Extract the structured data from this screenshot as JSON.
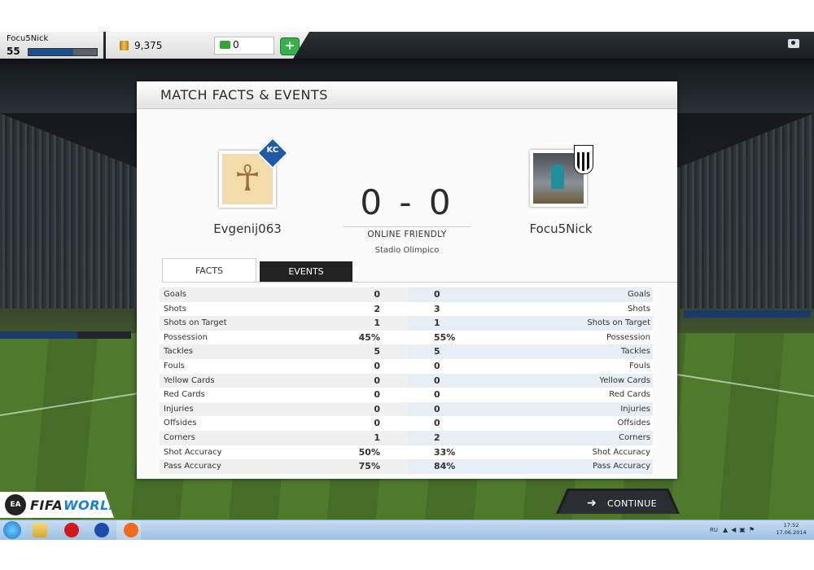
{
  "topbar": {
    "username": "Focu5Nick",
    "level": "55",
    "xp_progress": 0.65,
    "coins": "9,375",
    "points": "0",
    "add_label": "+"
  },
  "dialog": {
    "title": "MATCH FACTS & EVENTS",
    "score": "0 - 0",
    "match_type": "ONLINE FRIENDLY",
    "stadium": "Stadio Olimpico",
    "home_team": "Evgenij063",
    "away_team": "Focu5Nick",
    "home_badge_letters": "KC",
    "tabs": {
      "facts": "FACTS",
      "events": "EVENTS"
    }
  },
  "stats": [
    {
      "label": "Goals",
      "home": "0",
      "away": "0"
    },
    {
      "label": "Shots",
      "home": "2",
      "away": "3"
    },
    {
      "label": "Shots on Target",
      "home": "1",
      "away": "1"
    },
    {
      "label": "Possession",
      "home": "45%",
      "away": "55%"
    },
    {
      "label": "Tackles",
      "home": "5",
      "away": "5"
    },
    {
      "label": "Fouls",
      "home": "0",
      "away": "0"
    },
    {
      "label": "Yellow Cards",
      "home": "0",
      "away": "0"
    },
    {
      "label": "Red Cards",
      "home": "0",
      "away": "0"
    },
    {
      "label": "Injuries",
      "home": "0",
      "away": "0"
    },
    {
      "label": "Offsides",
      "home": "0",
      "away": "0"
    },
    {
      "label": "Corners",
      "home": "1",
      "away": "2"
    },
    {
      "label": "Shot Accuracy",
      "home": "50%",
      "away": "33%"
    },
    {
      "label": "Pass Accuracy",
      "home": "75%",
      "away": "84%"
    }
  ],
  "continue_label": "CONTINUE",
  "logo": {
    "ea": "EA",
    "fifa": "FIFA",
    "world": "WORLD"
  },
  "taskbar": {
    "language": "RU",
    "time": "17:52",
    "date": "17.06.2014"
  },
  "icons": {
    "coin": "coin-icon",
    "points": "fifa-points-icon",
    "camera": "camera-icon",
    "continue": "arrow-right-icon"
  },
  "colors": {
    "xp_bar": "#1c4f8f",
    "add_button": "#35b34a",
    "events_tab": "#222222",
    "world_logo": "#1b7fd6"
  }
}
